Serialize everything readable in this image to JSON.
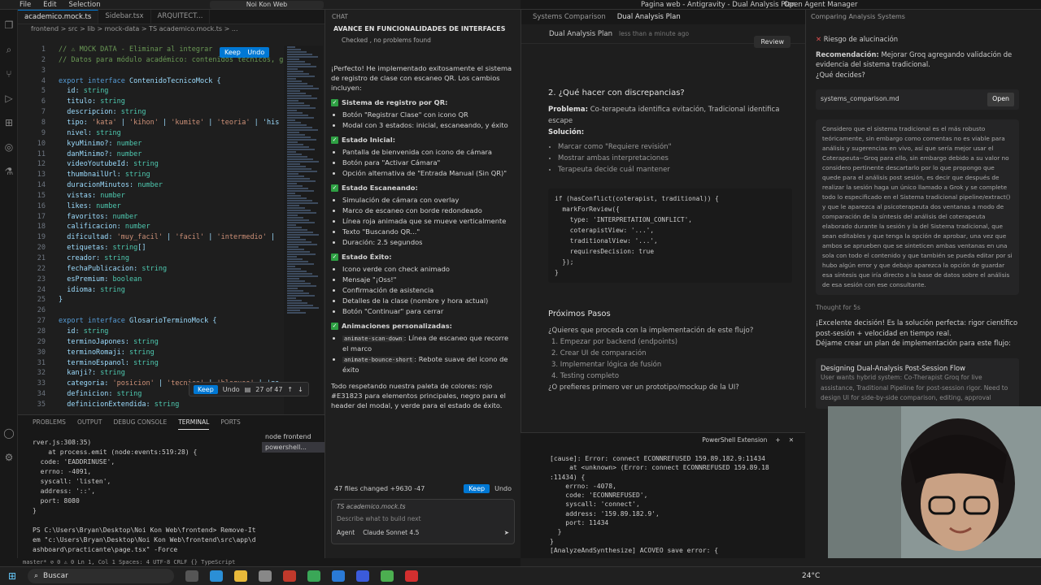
{
  "left_window": {
    "menu": [
      "File",
      "Edit",
      "Selection"
    ],
    "title": "Noi Kon Web",
    "tabs": [
      "academico.mock.ts",
      "Sidebar.tsx",
      "ARQUITECT..."
    ],
    "breadcrumb": "frontend > src > lib > mock-data > TS academico.mock.ts > ...",
    "keep_label": "Keep",
    "undo_label": "Undo",
    "change_counter": "27 of 47",
    "line_numbers": [
      "1",
      "2",
      "3",
      "4",
      "5",
      "6",
      "7",
      "8",
      "9",
      "10",
      "11",
      "12",
      "13",
      "14",
      "15",
      "16",
      "17",
      "18",
      "19",
      "20",
      "21",
      "22",
      "23",
      "24",
      "25",
      "26",
      "27",
      "28",
      "29",
      "30",
      "31",
      "32",
      "33",
      "34",
      "35"
    ],
    "code_lines": [
      "// ⚠ MOCK DATA - Eliminar al integrar",
      "// Datos para módulo académico: contenidos técnicos, gl",
      "",
      "export interface ContenidoTecnicoMock {",
      "  id: string",
      "  titulo: string",
      "  descripcion: string",
      "  tipo: 'kata' | 'kihon' | 'kumite' | 'teoria' | 'his",
      "  nivel: string",
      "  kyuMinimo?: number",
      "  danMinimo?: number",
      "  videoYoutubeId: string",
      "  thumbnailUrl: string",
      "  duracionMinutos: number",
      "  vistas: number",
      "  likes: number",
      "  favoritos: number",
      "  calificacion: number",
      "  dificultad: 'muy_facil' | 'facil' | 'intermedio' |",
      "  etiquetas: string[]",
      "  creador: string",
      "  fechaPublicacion: string",
      "  esPremium: boolean",
      "  idioma: string",
      "}",
      "",
      "export interface GlosarioTerminoMock {",
      "  id: string",
      "  terminoJapones: string",
      "  terminoRomaji: string",
      "  terminoEspanol: string",
      "  kanji?: string",
      "  categoria: 'posicion' | 'tecnica' | 'bloqueo' | 'go",
      "  definicion: string",
      "  definicionExtendida: string"
    ],
    "panel_tabs": [
      "PROBLEMS",
      "OUTPUT",
      "DEBUG CONSOLE",
      "TERMINAL",
      "PORTS"
    ],
    "terminal_lines": [
      "rver.js:308:35)",
      "    at process.emit (node:events:519:28) {",
      "  code: 'EADDRINUSE',",
      "  errno: -4091,",
      "  syscall: 'listen',",
      "  address: '::',",
      "  port: 8080",
      "}",
      "",
      "PS C:\\Users\\Bryan\\Desktop\\Noi Kon Web\\frontend> Remove-It",
      "em \"c:\\Users\\Bryan\\Desktop\\Noi Kon Web\\frontend\\src\\app\\d",
      "ashboard\\practicante\\page.tsx\" -Force",
      "",
      "PS C:\\Users\\Bryan\\Desktop\\Noi Kon Web\\frontend> "
    ],
    "terminal_list": [
      "node frontend",
      "powershell..."
    ],
    "status": "master*  ⊘ 0 ⚠ 0          Ln 1, Col 1   Spaces: 4   UTF-8   CRLF   {} TypeScript"
  },
  "chat": {
    "header": "CHAT",
    "title": "AVANCE EN FUNCIONALIDADES DE INTERFACES",
    "checked": "Checked , no problems found",
    "intro": "¡Perfecto! He implementado exitosamente el sistema de registro de clase con escaneo QR. Los cambios incluyen:",
    "sections": [
      {
        "title": "Sistema de registro por QR:",
        "items": [
          "Botón \"Registrar Clase\" con icono QR",
          "Modal con 3 estados: inicial, escaneando, y éxito"
        ]
      },
      {
        "title": "Estado Inicial:",
        "items": [
          "Pantalla de bienvenida con icono de cámara",
          "Botón para \"Activar Cámara\"",
          "Opción alternativa de \"Entrada Manual (Sin QR)\""
        ]
      },
      {
        "title": "Estado Escaneando:",
        "items": [
          "Simulación de cámara con overlay",
          "Marco de escaneo con borde redondeado",
          "Línea roja animada que se mueve verticalmente",
          "Texto \"Buscando QR...\"",
          "Duración: 2.5 segundos"
        ]
      },
      {
        "title": "Estado Éxito:",
        "items": [
          "Icono verde con check animado",
          "Mensaje \"¡Oss!\"",
          "Confirmación de asistencia",
          "Detalles de la clase (nombre y hora actual)",
          "Botón \"Continuar\" para cerrar"
        ]
      },
      {
        "title": "Animaciones personalizadas:",
        "items": []
      }
    ],
    "anim_items": [
      {
        "code": "animate-scan-down",
        "text": ": Línea de escaneo que recorre el marco"
      },
      {
        "code": "animate-bounce-short",
        "text": ": Rebote suave del icono de éxito"
      }
    ],
    "footer": "Todo respetando nuestra paleta de colores: rojo #E31823 para elementos principales, negro para el header del modal, y verde para el estado de éxito.",
    "changes": "47 files changed  +9630  -47",
    "keep": "Keep",
    "undo": "Undo",
    "attached_file": "TS academico.mock.ts",
    "input_placeholder": "Describe what to build next",
    "mode": "Agent",
    "model": "Claude Sonnet 4.5"
  },
  "right_window": {
    "title": "Pagina web - Antigravity - Dual Analysis Plan",
    "agent_manager": "Open Agent Manager",
    "tabs": [
      "Systems Comparison",
      "Dual Analysis Plan"
    ],
    "plan_title": "Dual Analysis Plan",
    "plan_time": "less than a minute ago",
    "review": "Review",
    "h2": "2. ¿Qué hacer con discrepancias?",
    "problema_label": "Problema:",
    "problema": "Co-terapeuta identifica evitación, Tradicional identifica escape",
    "solucion_label": "Solución:",
    "solucion_items": [
      "Marcar como \"Requiere revisión\"",
      "Mostrar ambas interpretaciones",
      "Terapeuta decide cuál mantener"
    ],
    "code": "if (hasConflict(coterapist, traditional)) {\n  markForReview({\n    type: 'INTERPRETATION_CONFLICT',\n    coterapistView: '...',\n    traditionalView: '...',\n    requiresDecision: true\n  });\n}",
    "next_title": "Próximos Pasos",
    "next_q": "¿Quieres que proceda con la implementación de este flujo?",
    "next_items": [
      "1. Empezar por backend (endpoints)",
      "2. Crear UI de comparación",
      "3. Implementar lógica de fusión",
      "4. Testing completo"
    ],
    "next_alt": "¿O prefieres primero ver un prototipo/mockup de la UI?",
    "terminal_header": "PowerShell Extension",
    "terminal": "[cause]: Error: connect ECONNREFUSED 159.89.182.9:11434\n     at <unknown> (Error: connect ECONNREFUSED 159.89.18\n:11434) {\n    errno: -4078,\n    code: 'ECONNREFUSED',\n    syscall: 'connect',\n    address: '159.89.182.9',\n    port: 11434\n  }\n}\n[AnalyzeAndSynthesize] ACOVEO save error: {"
  },
  "agent": {
    "title": "Comparing Analysis Systems",
    "risk": "Riesgo de alucinación",
    "rec_label": "Recomendación:",
    "rec": "Mejorar Groq agregando validación de evidencia del sistema tradicional.",
    "ask": "¿Qué decides?",
    "file": "systems_comparison.md",
    "open": "Open",
    "user_msg": "Considero que el sistema tradicional es el más robusto teóricamente, sin embargo como comentas no es viable para análisis y sugerencias en vivo, así que sería mejor usar el Coterapeuta--Groq para ello, sin embargo debido a su valor no considero pertinente descartarlo por lo que propongo que quede para el análisis post sesión, es decir que después de realizar la sesión haga un único llamado a Grok y se complete todo lo especificado en el Sistema tradicional pipeline/extract() y que le aparezca al psicoterapeuta dos ventanas a modo de comparación de la síntesis del análisis del coterapeuta elaborado durante la sesión y la del Sistema tradicional, que sean editables y que tenga la opción de aprobar, una vez que ambos se aprueben que se sinteticen ambas ventanas en una sola con todo el contenido y que también se pueda editar por si hubo algún error y que debajo aparezca la opción de guardar esa síntesis que iría directo a la base de datos sobre el análisis de esa sesión con ese consultante.",
    "thought": "Thought for 5s",
    "reply": "¡Excelente decisión! Es la solución perfecta: rigor científico post-sesión + velocidad en tiempo real.",
    "reply2": "Déjame crear un plan de implementación para este flujo:",
    "task_title": "Designing Dual-Analysis Post-Session Flow",
    "task_desc": "User wants hybrid system: Co-Therapist Groq for live assistance, Traditional Pipeline for post-session rigor. Need to design UI for side-by-side comparison, editing, approval"
  },
  "taskbar": {
    "search": "Buscar",
    "temp": "24°C"
  }
}
